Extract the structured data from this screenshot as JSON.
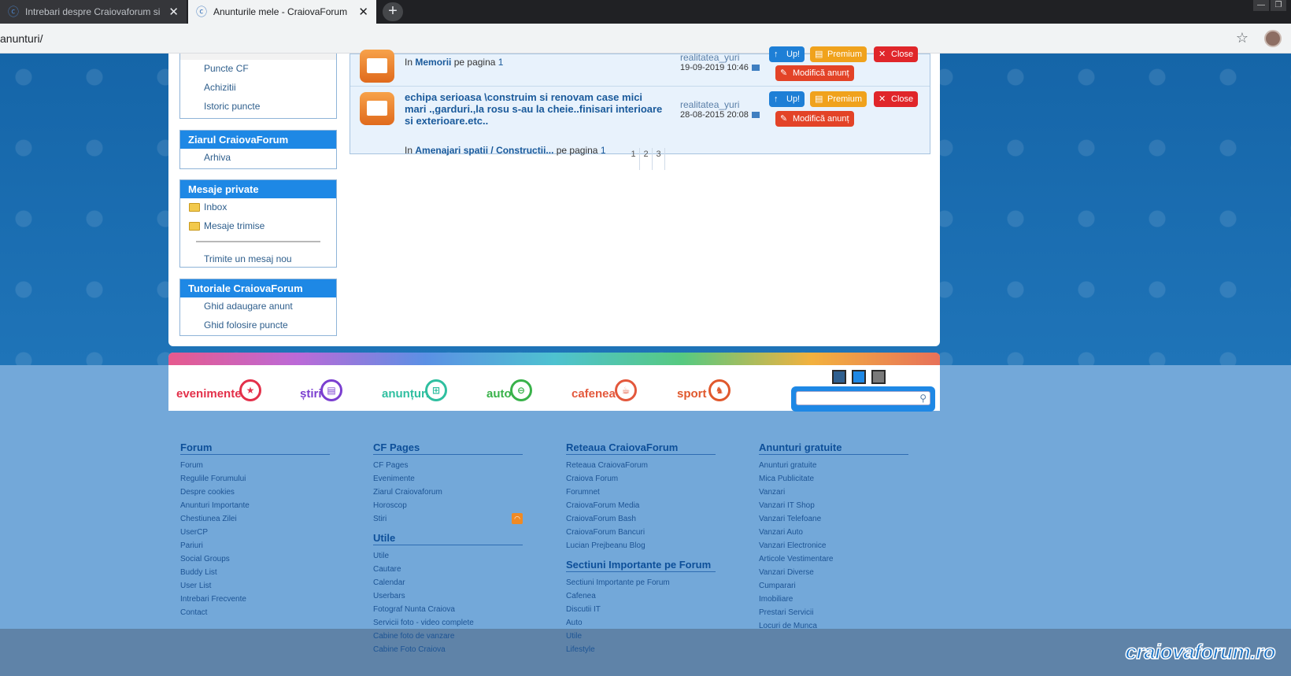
{
  "browser": {
    "tabs": [
      {
        "title": "Intrebari despre Craiovaforum si",
        "active": false
      },
      {
        "title": "Anunturile mele - CraiovaForum",
        "active": true
      }
    ],
    "new_tab": "+",
    "url": "anunturi/"
  },
  "sidebar": {
    "account_items": [
      "Puncte CF",
      "Achizitii",
      "Istoric puncte"
    ],
    "ziarul": {
      "head": "Ziarul CraiovaForum",
      "items": [
        "Arhiva"
      ]
    },
    "mesaje": {
      "head": "Mesaje private",
      "items": [
        "Inbox",
        "Mesaje trimise"
      ],
      "compose": "Trimite un mesaj nou"
    },
    "tutoriale": {
      "head": "Tutoriale CraiovaForum",
      "items": [
        "Ghid adaugare anunt",
        "Ghid folosire puncte"
      ]
    }
  },
  "listings": [
    {
      "in_label": "In",
      "section": "Memorii",
      "page_label": "pe pagina",
      "page": "1",
      "author": "realitatea_yuri",
      "date": "19-09-2019 10:46"
    },
    {
      "title": "echipa serioasa \\construim si renovam case mici mari .,garduri.,la rosu s-au la cheie..finisari interioare si exterioare.etc..",
      "in_label": "In",
      "section": "Amenajari spatii / Constructii...",
      "page_label": "pe pagina",
      "page": "1",
      "pages": [
        "1",
        "2",
        "3"
      ],
      "author": "realitatea_yuri",
      "date": "28-08-2015 20:08"
    }
  ],
  "buttons": {
    "up": "Up!",
    "premium": "Premium",
    "close": "Close",
    "modify": "Modifică anunț"
  },
  "categories": [
    {
      "label": "evenimente",
      "color": "#e3304a"
    },
    {
      "label": "știri",
      "color": "#7b3fd0"
    },
    {
      "label": "anunțuri",
      "color": "#2fbfa0"
    },
    {
      "label": "auto",
      "color": "#39b24a"
    },
    {
      "label": "cafenea",
      "color": "#e3583c"
    },
    {
      "label": "sport",
      "color": "#e0582c"
    }
  ],
  "theme_colors": [
    "#2f5f8f",
    "#1e88e5",
    "#7a7a7a"
  ],
  "footer": {
    "forum": {
      "head": "Forum",
      "links": [
        "Forum",
        "Regulile Forumului",
        "Despre cookies",
        "Anunturi Importante",
        "Chestiunea Zilei",
        "UserCP",
        "Pariuri",
        "Social Groups",
        "Buddy List",
        "User List",
        "Intrebari Frecvente",
        "Contact"
      ]
    },
    "cfpages": {
      "head": "CF Pages",
      "links": [
        "CF Pages",
        "Evenimente",
        "Ziarul Craiovaforum",
        "Horoscop",
        "Stiri"
      ]
    },
    "utile": {
      "head": "Utile",
      "links": [
        "Utile",
        "Cautare",
        "Calendar",
        "Userbars",
        "Fotograf Nunta Craiova",
        "Servicii foto - video complete",
        "Cabine foto de vanzare",
        "Cabine Foto Craiova"
      ]
    },
    "reteaua": {
      "head": "Reteaua CraiovaForum",
      "links": [
        "Reteaua CraiovaForum",
        "Craiova Forum",
        "Forumnet",
        "CraiovaForum Media",
        "CraiovaForum Bash",
        "CraiovaForum Bancuri",
        "Lucian Prejbeanu Blog"
      ]
    },
    "sectiuni": {
      "head": "Sectiuni Importante pe Forum",
      "links": [
        "Sectiuni Importante pe Forum",
        "Cafenea",
        "Discutii IT",
        "Auto",
        "Utile",
        "Lifestyle"
      ]
    },
    "anunturi": {
      "head": "Anunturi gratuite",
      "links": [
        "Anunturi gratuite",
        "Mica Publicitate",
        "Vanzari",
        "Vanzari IT Shop",
        "Vanzari Telefoane",
        "Vanzari Auto",
        "Vanzari Electronice",
        "Articole Vestimentare",
        "Vanzari Diverse",
        "Cumparari",
        "Imobiliare",
        "Prestari Servicii",
        "Locuri de Munca"
      ]
    }
  },
  "watermark": "craiovaforum.ro"
}
